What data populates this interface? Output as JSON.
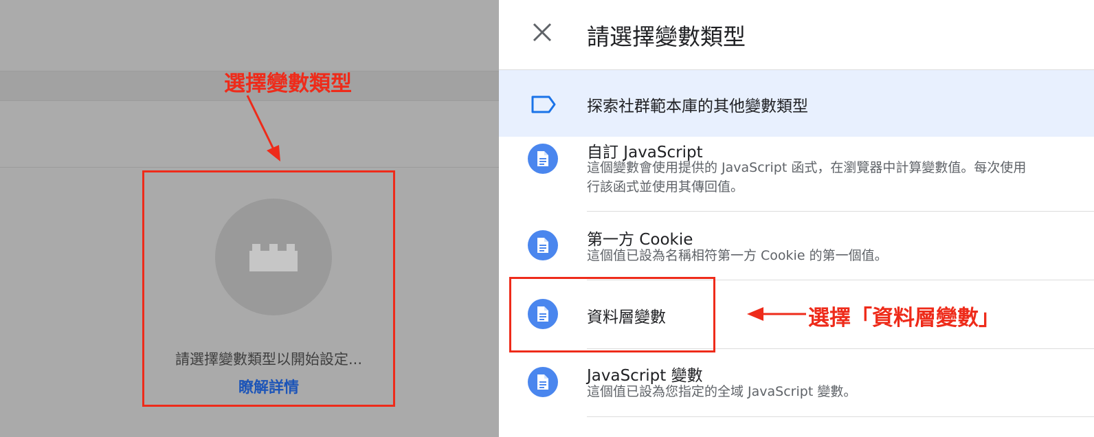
{
  "left": {
    "empty_state_text": "請選擇變數類型以開始設定...",
    "learn_more_link": "瞭解詳情",
    "brick_icon": "brick-icon"
  },
  "panel": {
    "title": "請選擇變數類型",
    "close_icon": "close-icon",
    "community_gallery": {
      "label": "探索社群範本庫的其他變數類型",
      "icon": "tag-icon"
    },
    "items": [
      {
        "title": "自訂 JavaScript",
        "desc_line1": "這個變數會使用提供的 JavaScript 函式，在瀏覽器中計算變數值。每次使用",
        "desc_line2": "行該函式並使用其傳回值。"
      },
      {
        "title": "第一方 Cookie",
        "desc_line1": "這個值已設為名稱相符第一方 Cookie 的第一個值。"
      },
      {
        "title": "資料層變數"
      },
      {
        "title": "JavaScript 變數",
        "desc_line1": "這個值已設為您指定的全域 JavaScript 變數。"
      }
    ],
    "item_icon": "document-icon"
  },
  "annotations": {
    "left_label": "選擇變數類型",
    "right_label": "選擇「資料層變數」",
    "color": "#ee2b1a"
  },
  "colors": {
    "accent": "#4a86ee",
    "link": "#1d55b8",
    "highlight_row": "#e8f0fe"
  }
}
